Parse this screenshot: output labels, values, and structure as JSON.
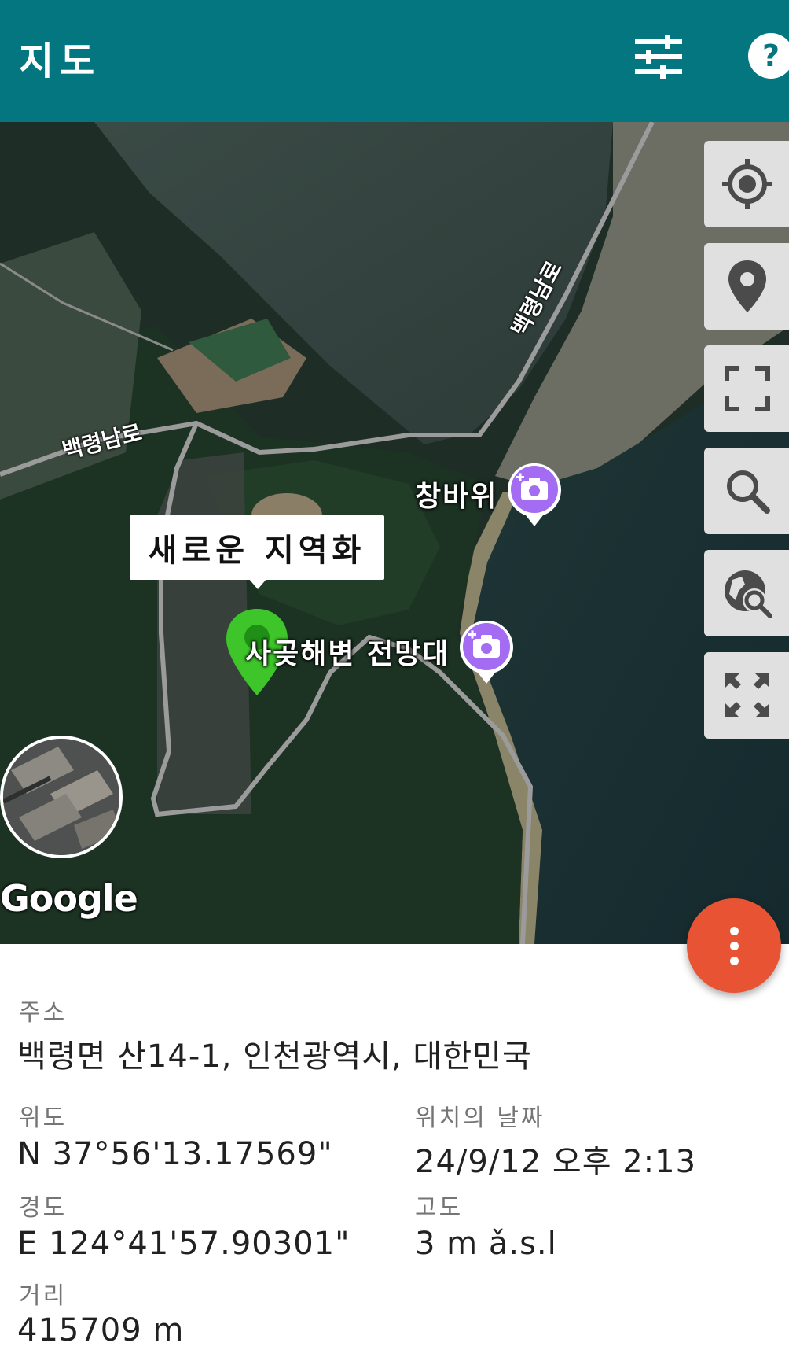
{
  "app_bar": {
    "title": "지도",
    "filter_icon": "tune-icon",
    "help_icon": "help-icon"
  },
  "map": {
    "callout_text": "새로운 지역화",
    "pois": [
      {
        "label": "창바위",
        "icon": "camera-plus-icon"
      },
      {
        "label": "사곶해변 전망대",
        "icon": "camera-plus-icon"
      }
    ],
    "road_labels": [
      "백령남로",
      "백령남로"
    ],
    "attribution": "Google",
    "side_buttons": [
      {
        "name": "my-location-button",
        "icon": "crosshair-icon"
      },
      {
        "name": "place-button",
        "icon": "map-pin-icon"
      },
      {
        "name": "fullscreen-button",
        "icon": "fullscreen-icon"
      },
      {
        "name": "search-button",
        "icon": "search-icon"
      },
      {
        "name": "globe-search-button",
        "icon": "globe-search-icon"
      },
      {
        "name": "expand-button",
        "icon": "expand-arrows-icon"
      }
    ],
    "fab_icon": "more-vertical-icon"
  },
  "colors": {
    "app_bar": "#04767f",
    "fab": "#e85433",
    "pin": "#3ec52a",
    "poi": "#a36cf2"
  },
  "info": {
    "address_label": "주소",
    "address_value": "백령면 산14-1, 인천광역시, 대한민국",
    "lat_label": "위도",
    "lat_value": "N 37°56'13.17569\"",
    "date_label": "위치의 날짜",
    "date_value": "24/9/12 오후 2:13",
    "lon_label": "경도",
    "lon_value": "E 124°41'57.90301\"",
    "alt_label": "고도",
    "alt_value": "3 m ǎ.s.l",
    "dist_label": "거리",
    "dist_value": "415709 m"
  }
}
